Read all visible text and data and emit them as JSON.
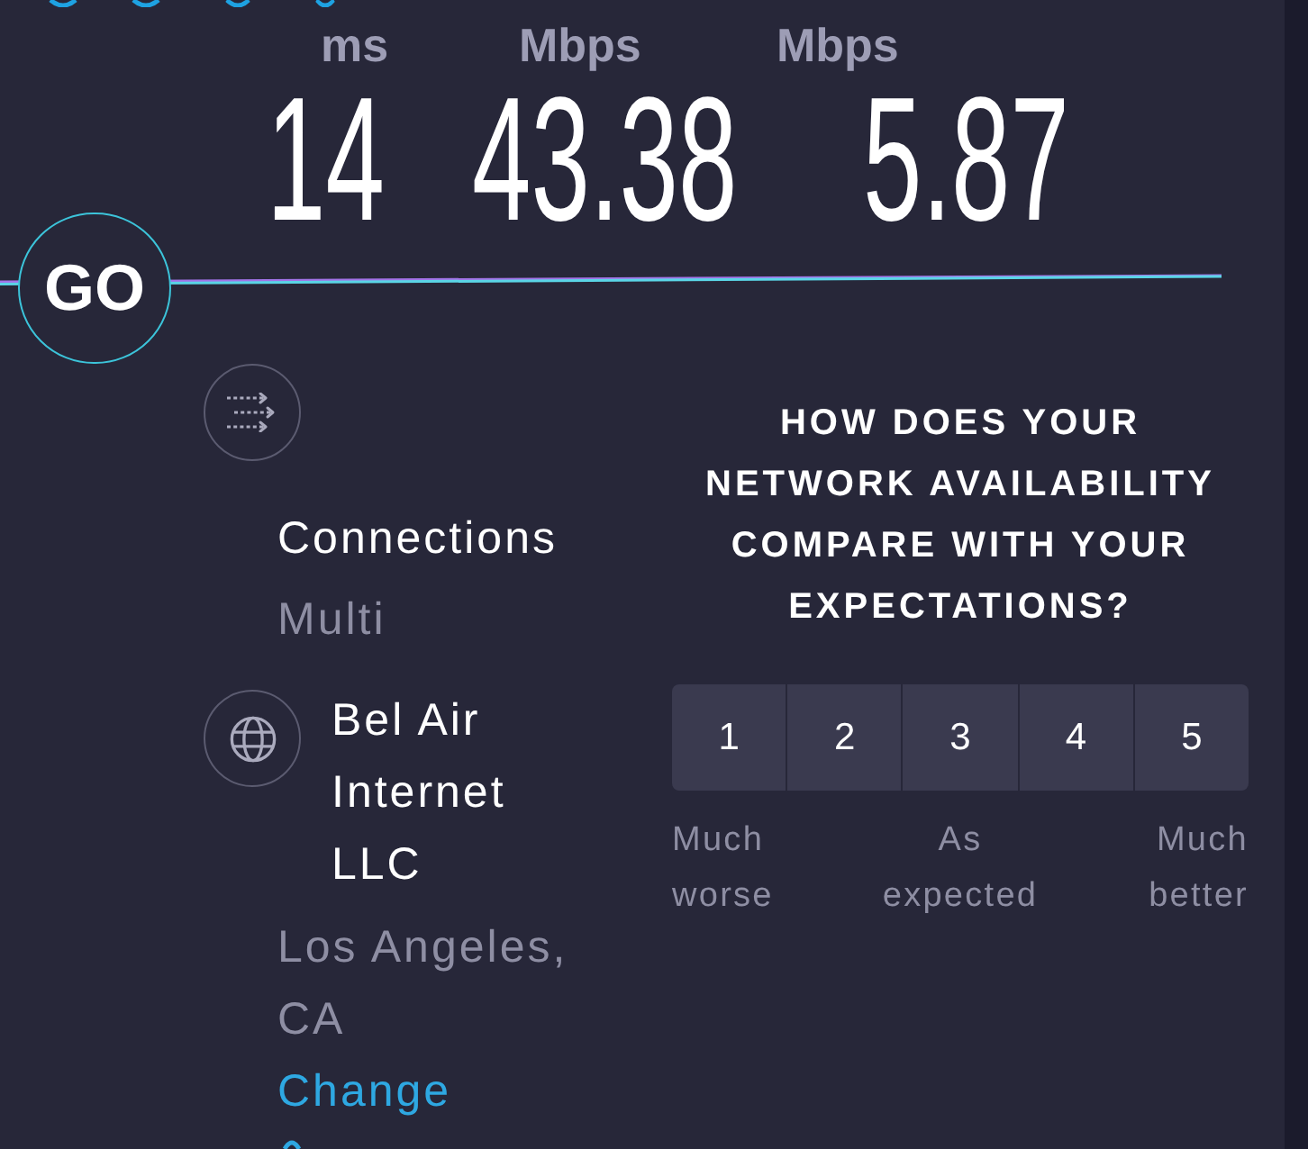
{
  "metrics": [
    {
      "unit": "ms",
      "value": "14"
    },
    {
      "unit": "Mbps",
      "value": "43.38"
    },
    {
      "unit": "Mbps",
      "value": "5.87"
    }
  ],
  "go_button": {
    "label": "GO"
  },
  "connections": {
    "label": "Connections",
    "value": "Multi"
  },
  "provider": {
    "name": "Bel Air Internet LLC",
    "location": "Los Angeles, CA",
    "link": "Change"
  },
  "survey": {
    "question": "HOW DOES YOUR NETWORK AVAILABILITY COMPARE WITH YOUR EXPECTATIONS?",
    "options": [
      {
        "label": "1",
        "selected": false
      },
      {
        "label": "2",
        "selected": false
      },
      {
        "label": "3",
        "selected": false
      },
      {
        "label": "4",
        "selected": false
      },
      {
        "label": "5",
        "selected": false
      }
    ],
    "scale_labels": [
      "Much worse",
      "As expected",
      "Much better"
    ]
  }
}
